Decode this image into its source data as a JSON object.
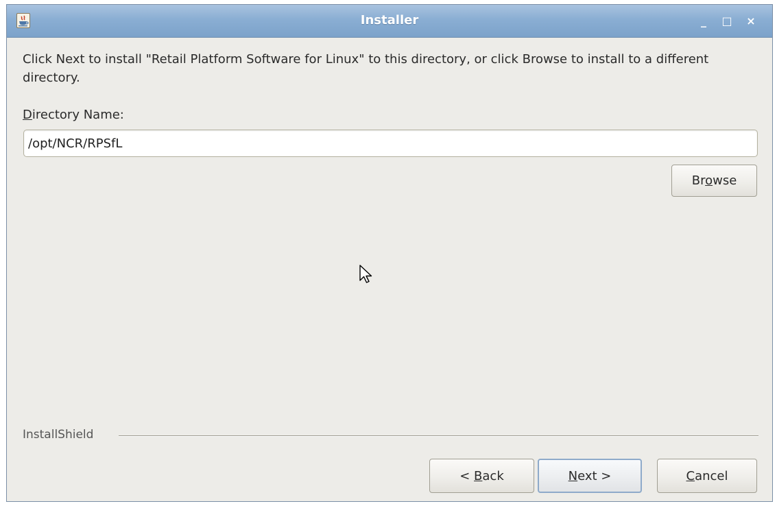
{
  "window": {
    "title": "Installer",
    "minimize_glyph": "_",
    "maximize_glyph": "□",
    "close_glyph": "×"
  },
  "content": {
    "instructions": "Click Next to install \"Retail Platform Software for Linux\" to this directory, or click Browse to install to a different directory.",
    "directory_label_mnemonic": "D",
    "directory_label_rest": "irectory Name:",
    "directory_value": "/opt/NCR/RPSfL"
  },
  "buttons": {
    "browse": {
      "pre": "Br",
      "mn": "o",
      "post": "wse"
    },
    "back": {
      "pre": "< ",
      "mn": "B",
      "post": "ack"
    },
    "next": {
      "pre": "",
      "mn": "N",
      "post": "ext >"
    },
    "cancel": {
      "pre": "",
      "mn": "C",
      "post": "ancel"
    }
  },
  "footer": {
    "brand": "InstallShield"
  },
  "icons": [
    "java-installer-icon",
    "minimize-icon",
    "maximize-icon",
    "close-icon",
    "mouse-cursor-icon"
  ],
  "colors": {
    "titlebar": "#8aaed3",
    "window_bg": "#edece8",
    "default_button_border": "#8eaaca"
  }
}
